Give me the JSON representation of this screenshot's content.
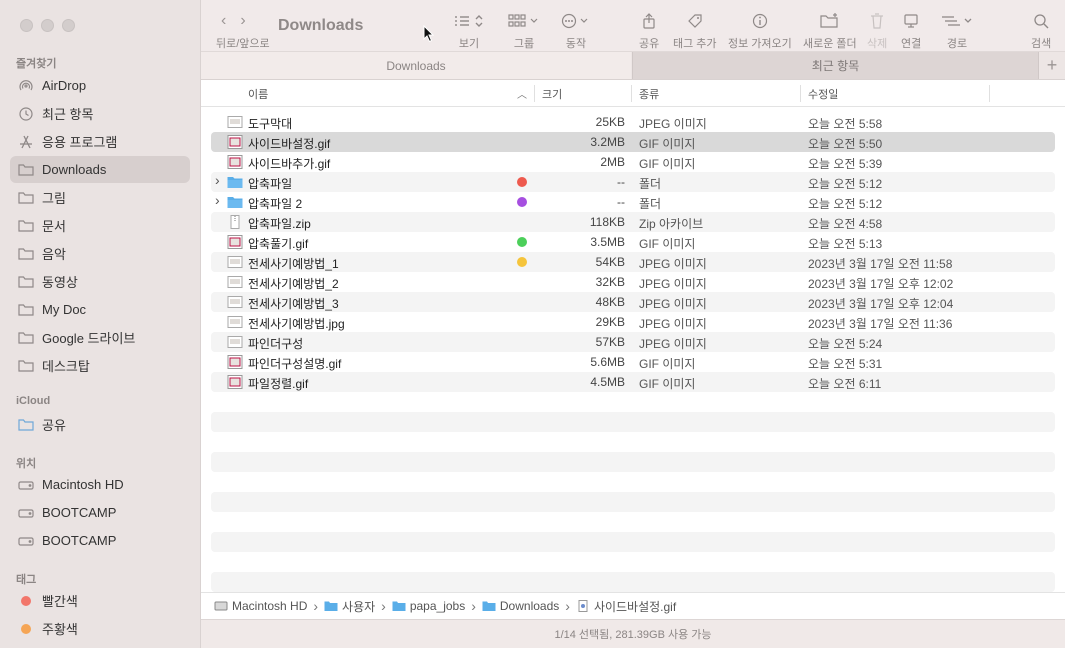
{
  "window": {
    "title": "Downloads"
  },
  "toolbar": {
    "nav_label": "뒤로/앞으로",
    "buttons": {
      "view": "보기",
      "group": "그룹",
      "action": "동작",
      "share": "공유",
      "tag": "태그 추가",
      "info": "정보 가져오기",
      "newfolder": "새로운 폴더",
      "delete": "삭제",
      "connect": "연결",
      "path": "경로",
      "search": "검색"
    }
  },
  "tabs": [
    {
      "label": "Downloads"
    },
    {
      "label": "최근 항목"
    }
  ],
  "sidebar": {
    "favorites_title": "즐겨찾기",
    "favorites": [
      "AirDrop",
      "최근 항목",
      "응용 프로그램",
      "Downloads",
      "그림",
      "문서",
      "음악",
      "동영상",
      "My Doc",
      "Google 드라이브",
      "데스크탑"
    ],
    "icloud_title": "iCloud",
    "icloud": [
      "공유"
    ],
    "locations_title": "위치",
    "locations": [
      "Macintosh HD",
      "BOOTCAMP",
      "BOOTCAMP"
    ],
    "tags_title": "태그",
    "tags": [
      {
        "label": "빨간색",
        "color": "#f2766a"
      },
      {
        "label": "주황색",
        "color": "#f5a555"
      }
    ]
  },
  "columns": {
    "name": "이름",
    "size": "크기",
    "kind": "종류",
    "date": "수정일"
  },
  "files": [
    {
      "name": "도구막대",
      "size": "25KB",
      "kind": "JPEG 이미지",
      "date": "오늘 오전 5:58",
      "tag": "",
      "folder": false
    },
    {
      "name": "사이드바설정.gif",
      "size": "3.2MB",
      "kind": "GIF 이미지",
      "date": "오늘 오전 5:50",
      "tag": "",
      "folder": false
    },
    {
      "name": "사이드바추가.gif",
      "size": "2MB",
      "kind": "GIF 이미지",
      "date": "오늘 오전 5:39",
      "tag": "",
      "folder": false
    },
    {
      "name": "압축파일",
      "size": "--",
      "kind": "폴더",
      "date": "오늘 오전 5:12",
      "tag": "#ee5a4e",
      "folder": true
    },
    {
      "name": "압축파일 2",
      "size": "--",
      "kind": "폴더",
      "date": "오늘 오전 5:12",
      "tag": "#a64fe0",
      "folder": true
    },
    {
      "name": "압축파일.zip",
      "size": "118KB",
      "kind": "Zip 아카이브",
      "date": "오늘 오전 4:58",
      "tag": "",
      "folder": false
    },
    {
      "name": "압축풀기.gif",
      "size": "3.5MB",
      "kind": "GIF 이미지",
      "date": "오늘 오전 5:13",
      "tag": "#4ccf5a",
      "folder": false
    },
    {
      "name": "전세사기예방법_1",
      "size": "54KB",
      "kind": "JPEG 이미지",
      "date": "2023년 3월 17일 오전 11:58",
      "tag": "#f5c43b",
      "folder": false
    },
    {
      "name": "전세사기예방법_2",
      "size": "32KB",
      "kind": "JPEG 이미지",
      "date": "2023년 3월 17일 오후 12:02",
      "tag": "",
      "folder": false
    },
    {
      "name": "전세사기예방법_3",
      "size": "48KB",
      "kind": "JPEG 이미지",
      "date": "2023년 3월 17일 오후 12:04",
      "tag": "",
      "folder": false
    },
    {
      "name": "전세사기예방법.jpg",
      "size": "29KB",
      "kind": "JPEG 이미지",
      "date": "2023년 3월 17일 오전 11:36",
      "tag": "",
      "folder": false
    },
    {
      "name": "파인더구성",
      "size": "57KB",
      "kind": "JPEG 이미지",
      "date": "오늘 오전 5:24",
      "tag": "",
      "folder": false
    },
    {
      "name": "파인더구성설명.gif",
      "size": "5.6MB",
      "kind": "GIF 이미지",
      "date": "오늘 오전 5:31",
      "tag": "",
      "folder": false
    },
    {
      "name": "파일정렬.gif",
      "size": "4.5MB",
      "kind": "GIF 이미지",
      "date": "오늘 오전 6:11",
      "tag": "",
      "folder": false
    }
  ],
  "selected_index": 1,
  "pathbar": [
    "Macintosh HD",
    "사용자",
    "papa_jobs",
    "Downloads",
    "사이드바설정.gif"
  ],
  "status": "1/14 선택됨, 281.39GB 사용 가능"
}
